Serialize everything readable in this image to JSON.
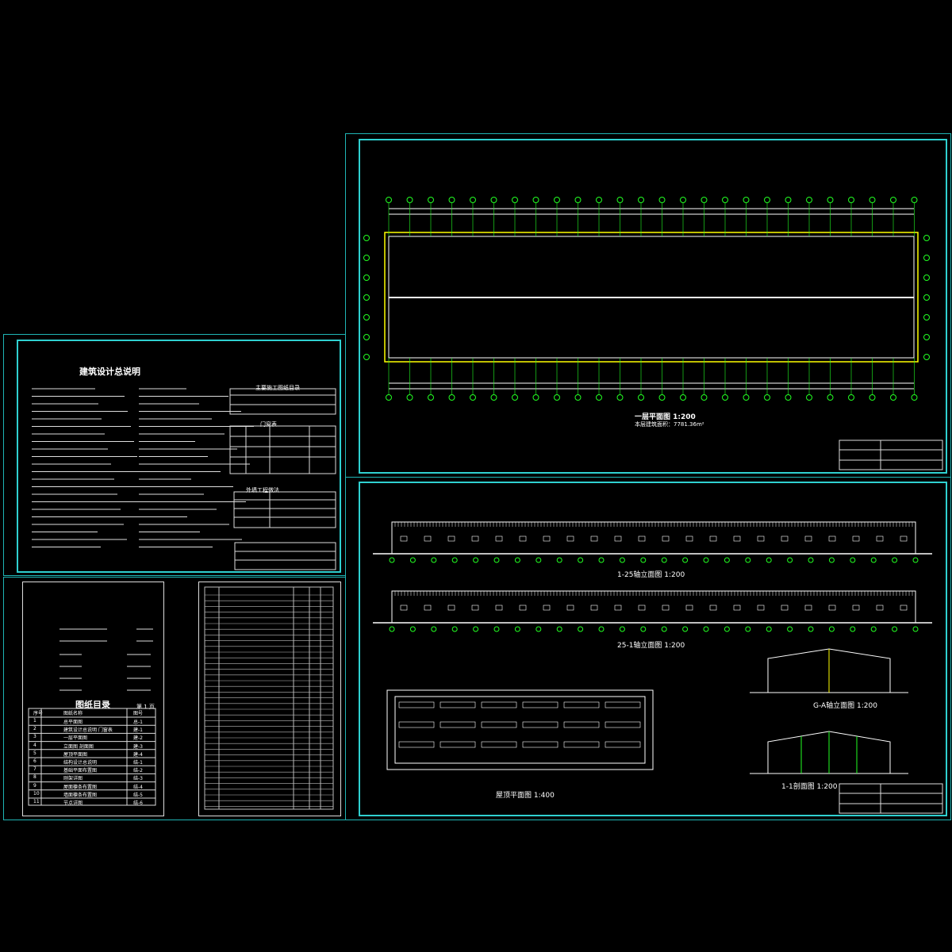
{
  "sheet1": {
    "title": "建筑设计总说明",
    "tables": {
      "table1_title": "主要施工图纸目录",
      "table2_title": "门窗表",
      "table3_title": "外墙工程做法"
    }
  },
  "sheet2": {
    "title": "图纸目录",
    "page_label": "第 1 页",
    "headers": [
      "序号",
      "图纸名称",
      "图号"
    ],
    "rows": [
      {
        "no": "1",
        "name": "总平面图",
        "code": "总-1"
      },
      {
        "no": "2",
        "name": "建筑设计总说明 门窗表",
        "code": "建-1"
      },
      {
        "no": "3",
        "name": "一层平面图",
        "code": "建-2"
      },
      {
        "no": "4",
        "name": "立面图 剖面图",
        "code": "建-3"
      },
      {
        "no": "5",
        "name": "屋顶平面图",
        "code": "建-4"
      },
      {
        "no": "6",
        "name": "结构设计总说明",
        "code": "结-1"
      },
      {
        "no": "7",
        "name": "基础平面布置图",
        "code": "结-2"
      },
      {
        "no": "8",
        "name": "刚架详图",
        "code": "结-3"
      },
      {
        "no": "9",
        "name": "屋面檩条布置图",
        "code": "结-4"
      },
      {
        "no": "10",
        "name": "墙面檩条布置图",
        "code": "结-5"
      },
      {
        "no": "11",
        "name": "节点详图",
        "code": "结-6"
      }
    ]
  },
  "sheet4": {
    "title_plan": "一层平面图 1:200",
    "area_note": "本层建筑面积：7781.36m²"
  },
  "sheet5": {
    "elev1": "1-25轴立面图 1:200",
    "elev2": "25-1轴立面图 1:200",
    "elev3": "G-A轴立面图 1:200",
    "roof": "屋顶平面图 1:400",
    "section": "1-1剖面图 1:200"
  },
  "colors": {
    "frame": "#2fd0d0",
    "line": "#ffffff",
    "axis": "#22ff22",
    "accent": "#ffff00"
  }
}
